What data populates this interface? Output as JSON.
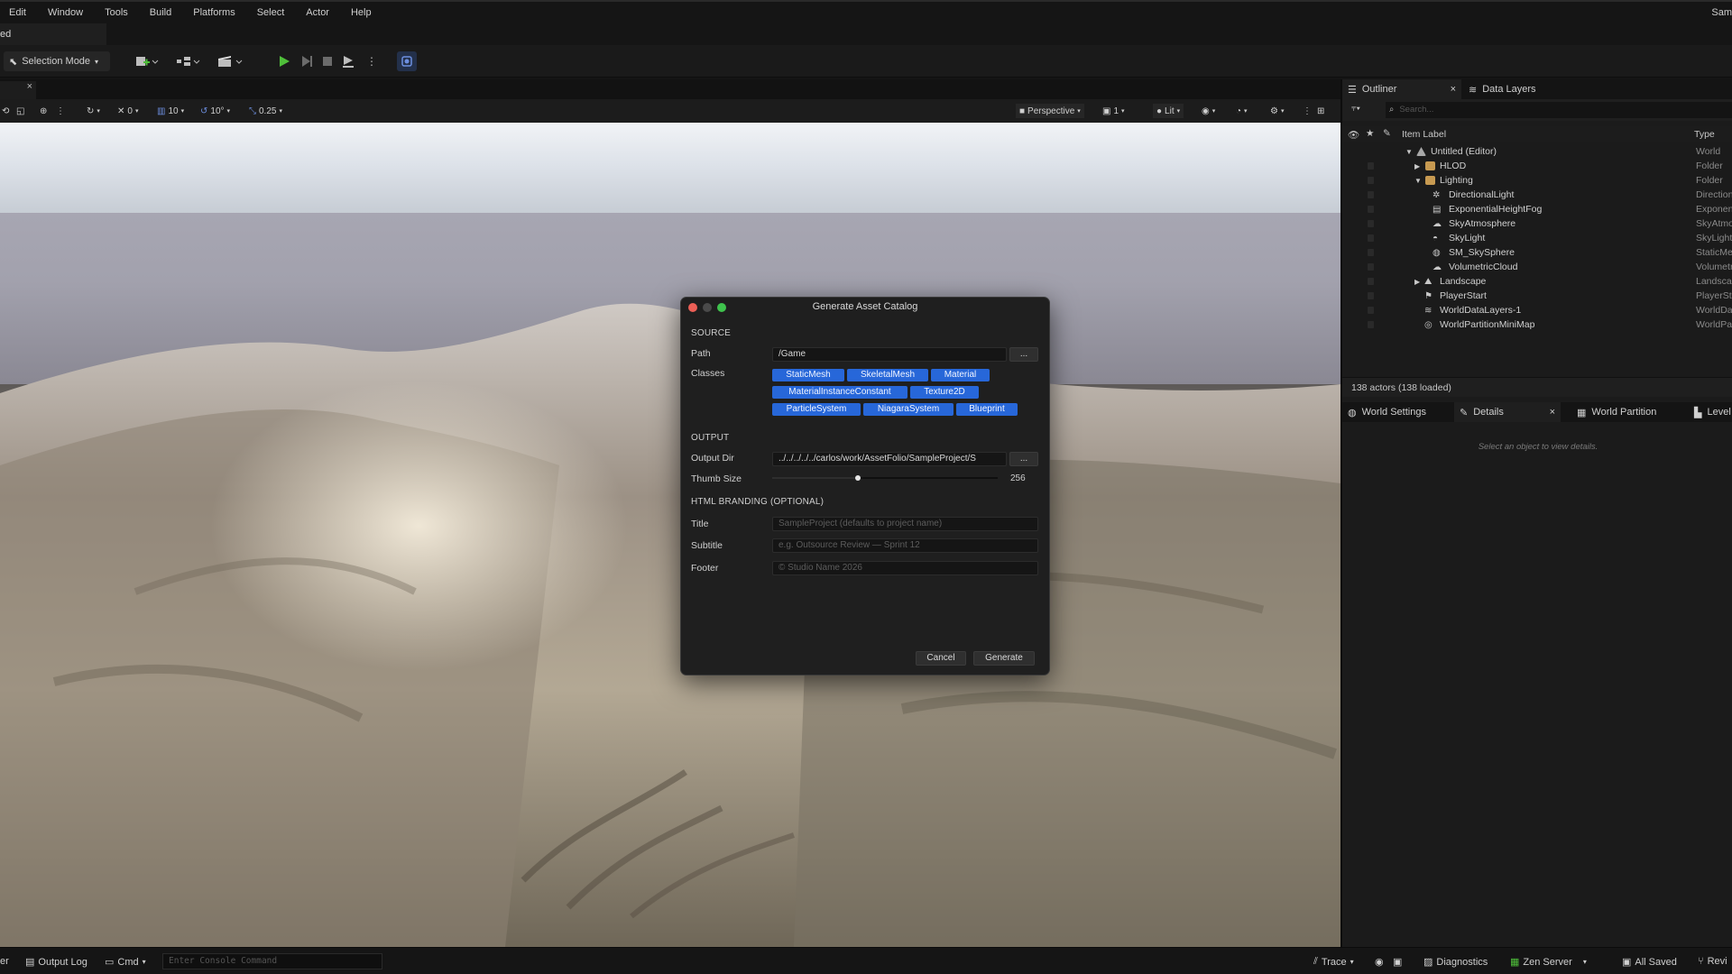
{
  "menu": {
    "items": [
      "Edit",
      "Window",
      "Tools",
      "Build",
      "Platforms",
      "Select",
      "Actor",
      "Help"
    ],
    "user_truncated": "Sam"
  },
  "editor_tab": {
    "label": "ed"
  },
  "toolbar": {
    "selection_mode_label": "Selection Mode"
  },
  "viewport_toolbar": {
    "translate_snap": "0",
    "grid_snap": "10",
    "rotation_snap": "10°",
    "scale_snap": "0.25",
    "view_mode_label": "Perspective",
    "layer_count": "1",
    "lighting_label": "Lit"
  },
  "outliner": {
    "tab_label": "Outliner",
    "data_layers_label": "Data Layers",
    "search_placeholder": "Search...",
    "col_item_label": "Item Label",
    "col_type": "Type",
    "rows": [
      {
        "label": "Untitled (Editor)",
        "type": "World",
        "icon": "world-icon"
      },
      {
        "label": "HLOD",
        "type": "Folder",
        "icon": "folder-icon"
      },
      {
        "label": "Lighting",
        "type": "Folder",
        "icon": "folder-icon"
      },
      {
        "label": "DirectionalLight",
        "type": "Direction",
        "icon": "sun-icon"
      },
      {
        "label": "ExponentialHeightFog",
        "type": "Exponen",
        "icon": "fog-icon"
      },
      {
        "label": "SkyAtmosphere",
        "type": "SkyAtmo",
        "icon": "atmosphere-icon"
      },
      {
        "label": "SkyLight",
        "type": "SkyLight",
        "icon": "skylight-icon"
      },
      {
        "label": "SM_SkySphere",
        "type": "StaticMe",
        "icon": "sphere-icon"
      },
      {
        "label": "VolumetricCloud",
        "type": "Volumetr",
        "icon": "cloud-icon"
      },
      {
        "label": "Landscape",
        "type": "Landsca",
        "icon": "landscape-icon"
      },
      {
        "label": "PlayerStart",
        "type": "PlayerSt",
        "icon": "flag-icon"
      },
      {
        "label": "WorldDataLayers-1",
        "type": "WorldDa",
        "icon": "layers-icon"
      },
      {
        "label": "WorldPartitionMiniMap",
        "type": "WorldPar",
        "icon": "minimap-icon"
      }
    ],
    "actor_count": "138 actors (138 loaded)"
  },
  "details": {
    "tabs": [
      "World Settings",
      "Details",
      "World Partition",
      "Level"
    ],
    "empty_text": "Select an object to view details."
  },
  "statusbar": {
    "left_truncated": "er",
    "output_log": "Output Log",
    "cmd": "Cmd",
    "console_placeholder": "Enter Console Command",
    "trace": "Trace",
    "diagnostics": "Diagnostics",
    "zen_server": "Zen Server",
    "all_saved": "All Saved",
    "revision_truncated": "Revi"
  },
  "dialog": {
    "title": "Generate Asset Catalog",
    "source_header": "SOURCE",
    "path_label": "Path",
    "path_value": "/Game",
    "browse_label": "...",
    "classes_label": "Classes",
    "classes": [
      "StaticMesh",
      "SkeletalMesh",
      "Material",
      "MaterialInstanceConstant",
      "Texture2D",
      "ParticleSystem",
      "NiagaraSystem",
      "Blueprint"
    ],
    "output_header": "OUTPUT",
    "output_dir_label": "Output Dir",
    "output_dir_value": "../../../../../carlos/work/AssetFolio/SampleProject/S",
    "thumb_size_label": "Thumb Size",
    "thumb_size_value": "256",
    "thumb_size_fraction": 0.38,
    "branding_header": "HTML BRANDING (OPTIONAL)",
    "title_label": "Title",
    "title_placeholder": "SampleProject  (defaults to project name)",
    "subtitle_label": "Subtitle",
    "subtitle_placeholder": "e.g. Outsource Review — Sprint 12",
    "footer_label": "Footer",
    "footer_placeholder": "© Studio Name 2026",
    "cancel_label": "Cancel",
    "generate_label": "Generate"
  },
  "colors": {
    "accent_blue": "#2767d9",
    "play_green": "#4fbf3a",
    "folder_yellow": "#c79a51",
    "close_red": "#ec5f56",
    "zoom_green": "#3fc34d"
  }
}
